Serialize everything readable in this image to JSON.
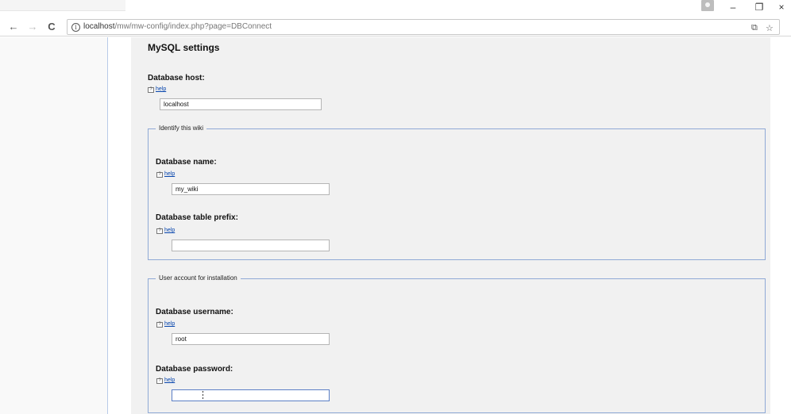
{
  "browser": {
    "url_host": "localhost",
    "url_path": "/mw/mw-config/index.php?page=DBConnect",
    "back_glyph": "←",
    "forward_glyph": "→",
    "reload_glyph": "C",
    "info_glyph": "i",
    "window_minimize": "–",
    "window_restore": "❐",
    "window_close": "×",
    "translate_glyph": "⧉",
    "star_glyph": "☆"
  },
  "form": {
    "title": "MySQL settings",
    "db_host": {
      "label": "Database host:",
      "help": "help",
      "value": "localhost"
    },
    "identify_fieldset": {
      "legend": "Identify this wiki",
      "db_name": {
        "label": "Database name:",
        "help": "help",
        "value": "my_wiki"
      },
      "db_prefix": {
        "label": "Database table prefix:",
        "help": "help",
        "value": ""
      }
    },
    "account_fieldset": {
      "legend": "User account for installation",
      "db_user": {
        "label": "Database username:",
        "help": "help",
        "value": "root"
      },
      "db_password": {
        "label": "Database password:",
        "help": "help",
        "value": ""
      }
    },
    "help_icon_glyph": "?"
  }
}
